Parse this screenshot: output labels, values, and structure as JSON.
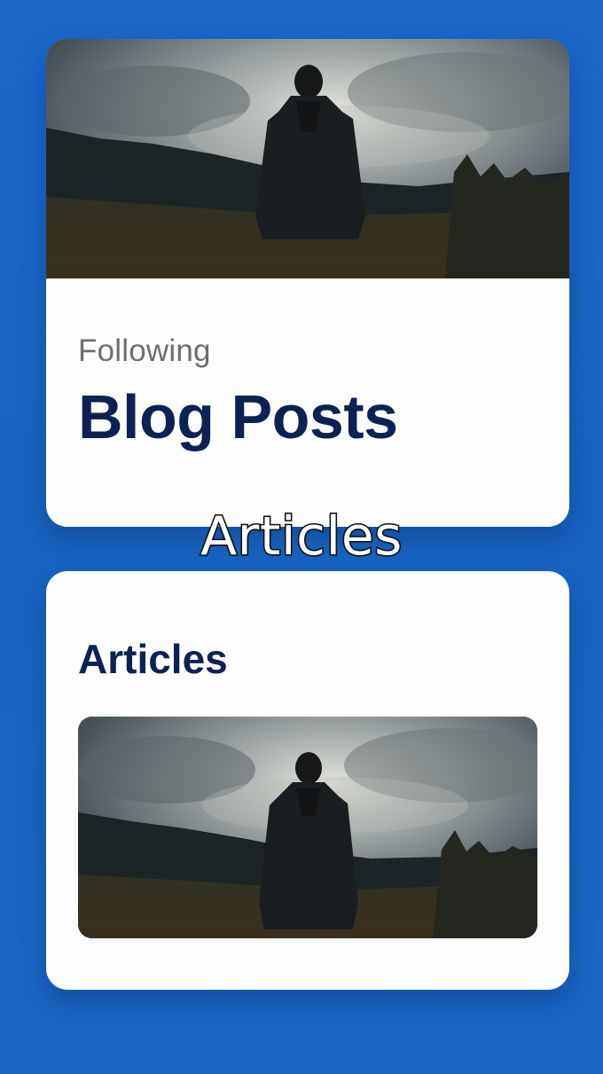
{
  "hero": {
    "eyebrow": "Following",
    "title": "Blog Posts",
    "image": "man-in-coat-standing-in-field-under-cloudy-sky"
  },
  "caption": "Articles",
  "articles": {
    "title": "Articles",
    "thumbnail": "man-in-coat-standing-in-field-under-cloudy-sky"
  },
  "colors": {
    "background": "#1a66c6",
    "card": "#fdfdfd",
    "title": "#0d2253",
    "eyebrow": "#6e6e6e"
  }
}
